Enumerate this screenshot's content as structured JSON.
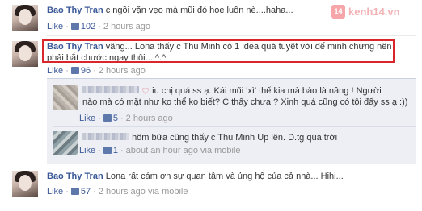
{
  "watermark": {
    "badge": "14",
    "brand": "kenh14.vn"
  },
  "comments": [
    {
      "author": "Bao Thy Tran",
      "text": "c ngồi vặn vẹo mà mũi đó hoe luôn nè....haha...",
      "like_label": "Like",
      "like_count": "102",
      "time": "2 hours ago"
    },
    {
      "author": "Bao Thy Tran",
      "text_line1": "vâng... Lona thấy c Thu Minh có 1 idea quá tuyệt vời để minh chứng nên",
      "text_line2": "phải bắt chước ngay thôi... ^.^",
      "like_label": "Like",
      "like_count": "96",
      "time": "2 hours ago"
    },
    {
      "author": "Bao Thy Tran",
      "text": "Lona rất cám ơn sự quan tâm và ủng hộ của cả nhà... Hihi...",
      "like_label": "Like",
      "like_count": "57",
      "time": "2 hours ago",
      "source": "via mobile"
    }
  ],
  "replies": [
    {
      "text_line1": "iu chị quá ss ạ. Kái mũi 'xì' thế kia mà bảo là nâng ! Người",
      "text_line2": "nào mà có mặt như ko thể ko biết? C thấy chưa ? Xinh quá cũng có tội đấy ss ạ :))",
      "like_label": "Like",
      "like_count": "5",
      "time": "2 hours ago"
    },
    {
      "text": "hôm bữa cũng thấy c Thu Minh Up lên. D.tg qúa trời",
      "like_label": "Like",
      "like_count": "1",
      "time": "about an hour ago",
      "source": "via mobile"
    }
  ]
}
